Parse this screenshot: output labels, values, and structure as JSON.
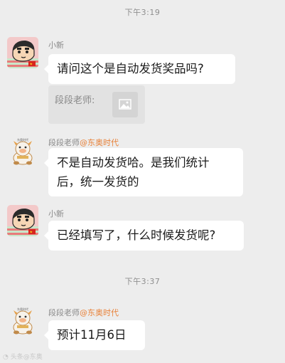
{
  "timestamps": [
    "下午3:19",
    "下午3:37"
  ],
  "messages": [
    {
      "sender": "小新",
      "text": "请问这个是自动发货奖品吗?",
      "quote": {
        "label": "段段老师:"
      }
    },
    {
      "sender": "段段老师",
      "sender_tag": "@东奥时代",
      "lines": [
        "不是自动发货哈。是我们统计",
        "后，统一发货的"
      ]
    },
    {
      "sender": "小新",
      "text": "已经填写了，什么时候发货呢?"
    },
    {
      "sender": "段段老师",
      "sender_tag": "@东奥时代",
      "text": "预计11月6日"
    }
  ],
  "watermark": "头条@东奥",
  "icons": {
    "user_avatar": "crayon-shin-chan-avatar",
    "teacher_avatar": "cartoon-mascot-avatar",
    "quote_image": "image-placeholder-icon"
  },
  "colors": {
    "background": "#ededed",
    "bubble": "#ffffff",
    "tag": "#e8823a",
    "meta_text": "#8a8a8a"
  }
}
